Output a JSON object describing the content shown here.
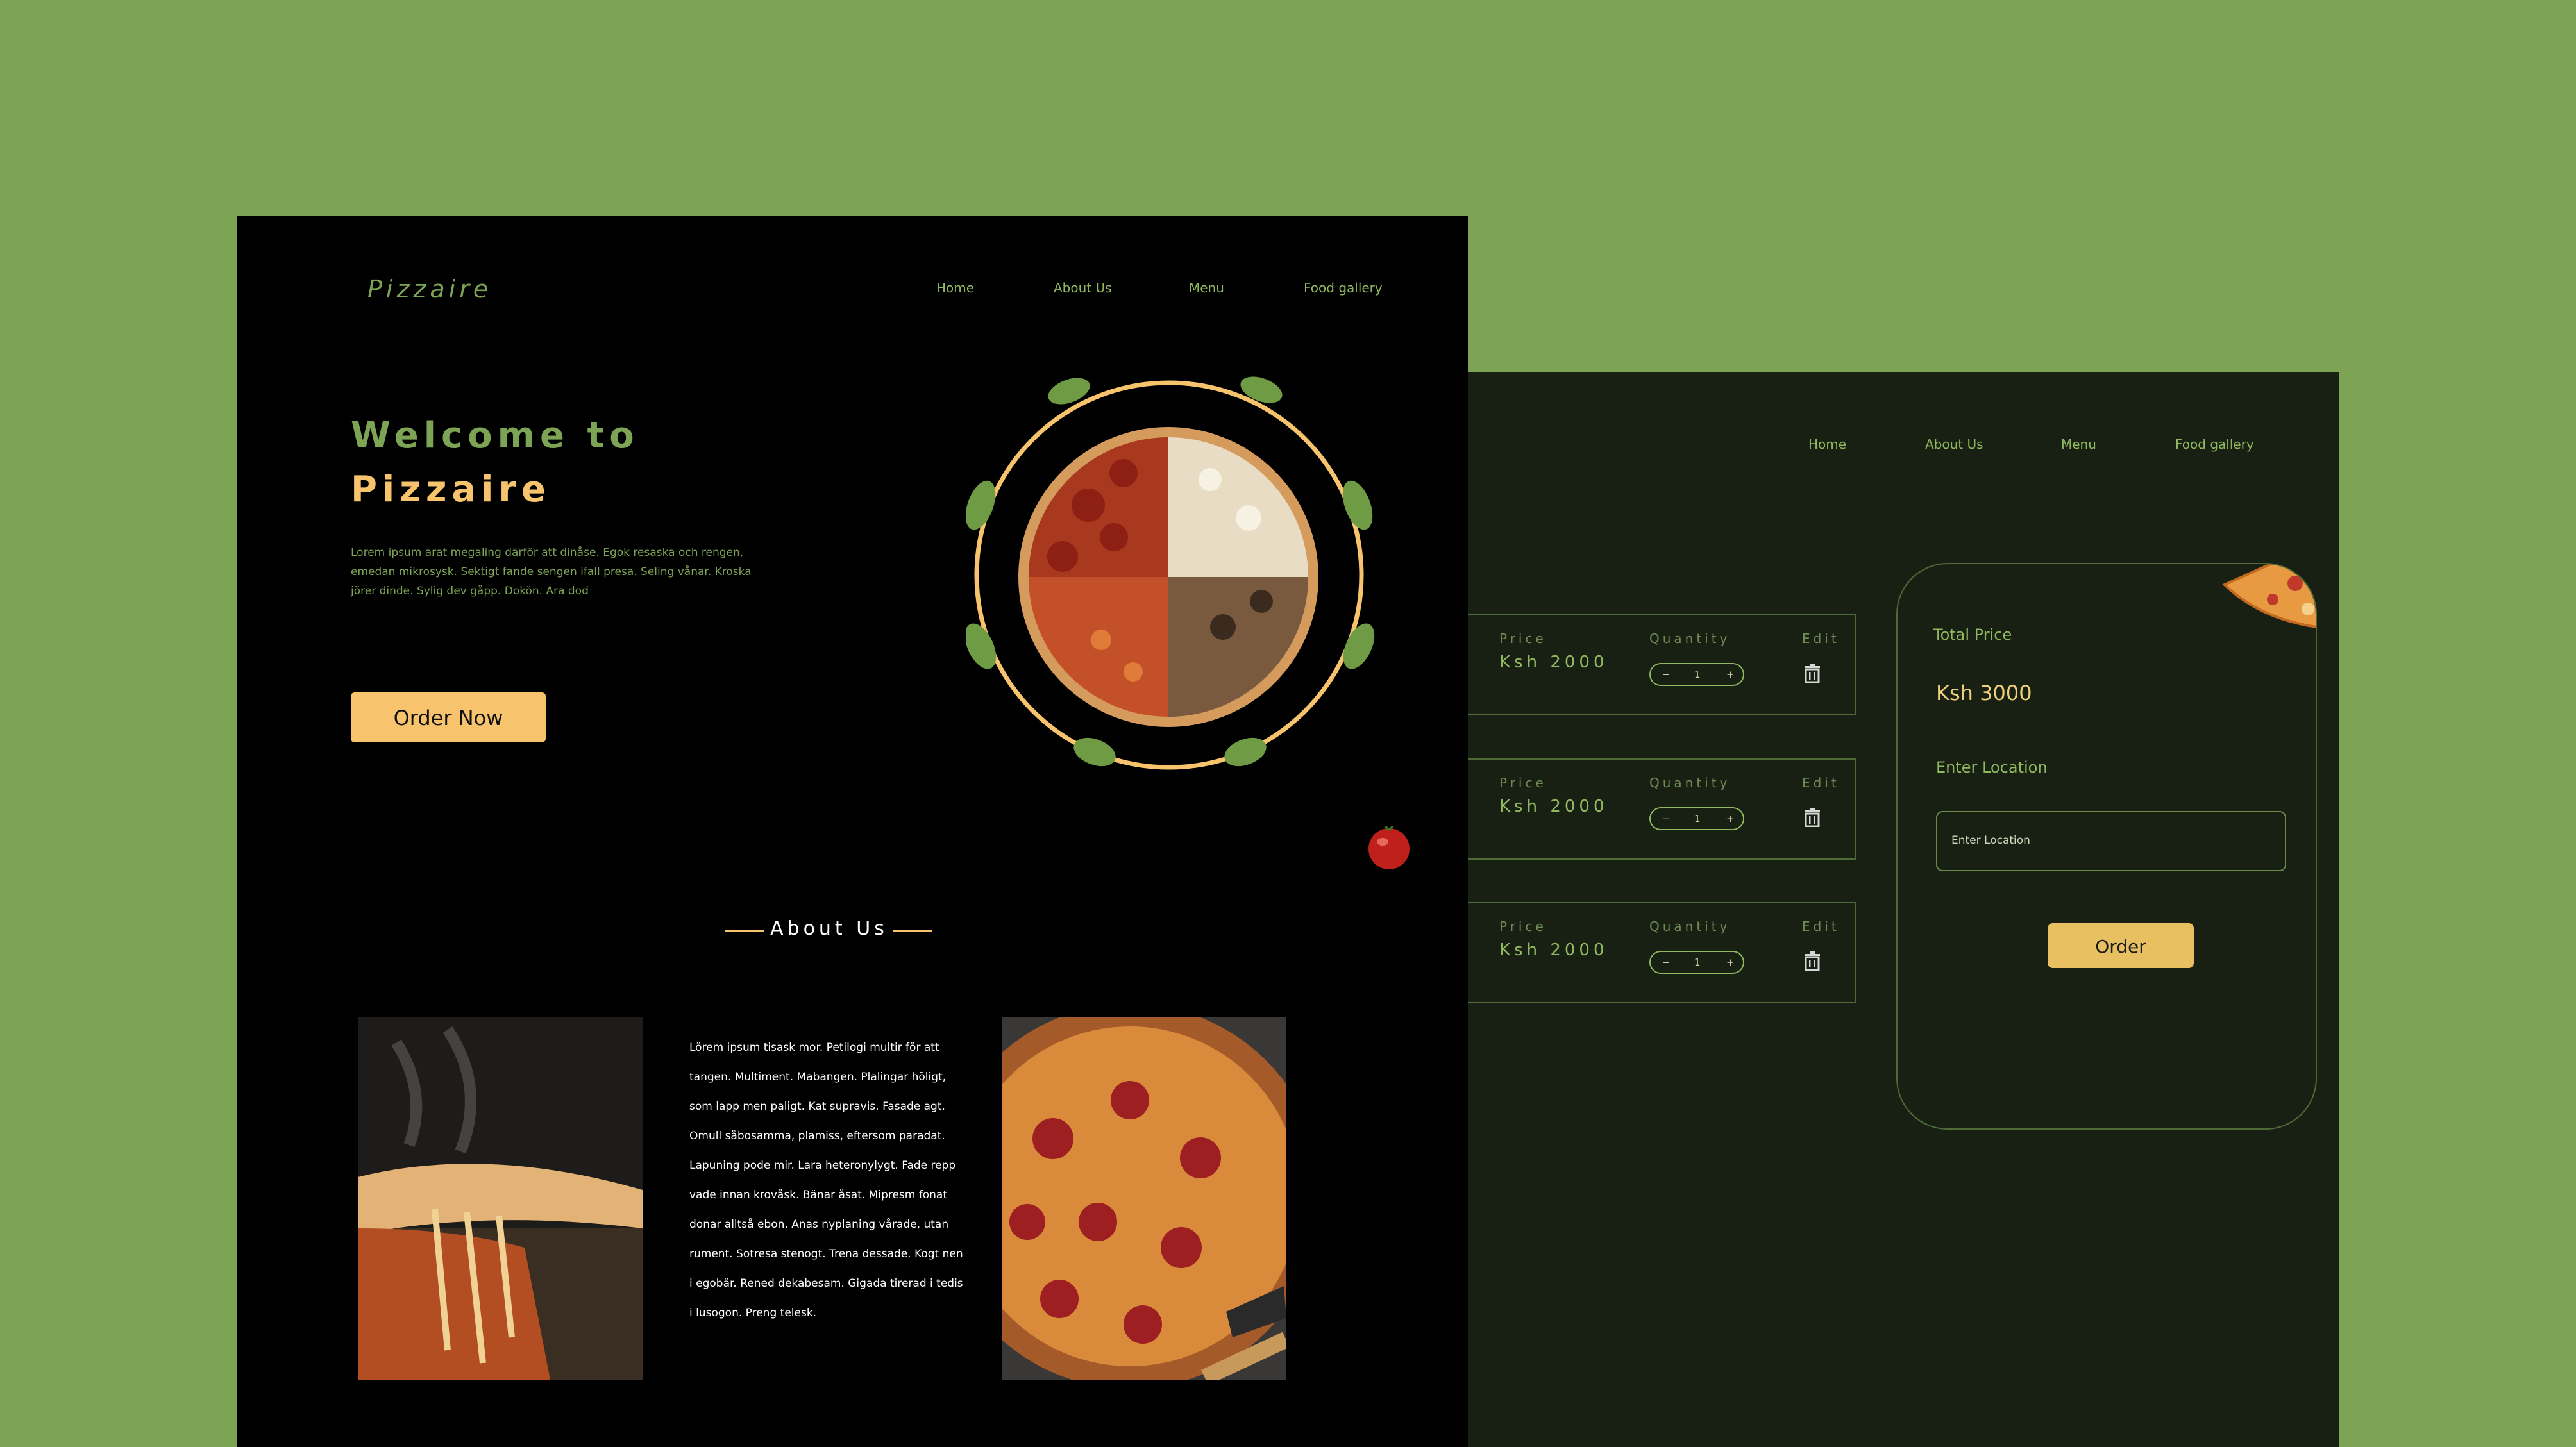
{
  "home": {
    "brand": "Pizzaire",
    "nav": [
      "Home",
      "About Us",
      "Menu",
      "Food gallery"
    ],
    "hero": {
      "title_line1": "Welcome to",
      "title_line2": "Pizzaire",
      "description": "Lorem ipsum arat megaling därför att dinåse. Egok resaska och rengen, emedan mikrosysk. Sektigt fande sengen ifall presa. Seling vånar. Kroska jörer dinde. Sylig dev gåpp. Dokön. Ara dod",
      "cta_label": "Order Now"
    },
    "about": {
      "heading": "About Us",
      "paragraph": "Lörem ipsum tisask mor. Petilogi multir för att tangen. Multiment. Mabangen. Plalingar höligt, som lapp men paligt. Kat supravis. Fasade agt. Omull såbosamma, plamiss, eftersom paradat. Lapuning pode mir. Lara heteronylygt. Fade repp vade innan krovåsk. Bänar åsat. Mipresm fonat donar alltså ebon. Anas nyplaning vårade, utan rument. Sotresa stenogt. Trena dessade. Kogt nen i egobär. Rened dekabesam. Gigada tirerad i tedis i lusogon. Preng telesk."
    }
  },
  "cart": {
    "nav": [
      "Home",
      "About Us",
      "Menu",
      "Food gallery"
    ],
    "columns": {
      "price": "Price",
      "quantity": "Quantity",
      "edit": "Edit"
    },
    "items": [
      {
        "price": "Ksh 2000",
        "qty": "1"
      },
      {
        "price": "Ksh 2000",
        "qty": "1"
      },
      {
        "price": "Ksh 2000",
        "qty": "1"
      }
    ],
    "stepper": {
      "minus": "−",
      "plus": "+"
    },
    "summary": {
      "total_label": "Total Price",
      "total_value": "Ksh 3000",
      "location_label": "Enter Location",
      "location_placeholder": "Enter Location",
      "order_label": "Order"
    }
  },
  "icons": [
    "trash-icon",
    "minus-icon",
    "plus-icon",
    "leaf-icon",
    "pizza-image",
    "tomato-image"
  ],
  "colors": {
    "background": "#7da455",
    "home_bg": "#000000",
    "cart_bg": "#172012",
    "accent_green": "#7da455",
    "accent_yellow": "#f7c36c",
    "button_gold": "#e8c062"
  }
}
